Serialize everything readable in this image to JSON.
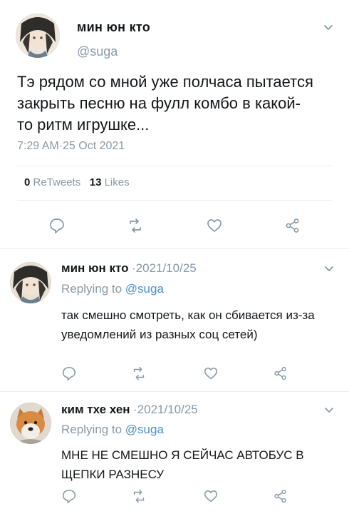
{
  "main_tweet": {
    "author_name": "мин юн кто",
    "handle": "@suga",
    "text": "Тэ рядом со мной уже полчаса пытается закрыть песню на фулл комбо в какой-то ритм игрушке...",
    "timestamp": "7:29 AM·25 Oct 2021",
    "retweets_count": "0",
    "retweets_label": "ReTweets",
    "likes_count": "13",
    "likes_label": "Likes"
  },
  "replies": [
    {
      "author_name": "мин юн кто",
      "date": "·2021/10/25",
      "replying_prefix": "Replying to",
      "replying_handle": "@suga",
      "text": "так смешно смотреть, как он сбивается из-за уведомлений из разных соц сетей)"
    },
    {
      "author_name": "ким тхе хен",
      "date": "·2021/10/25",
      "replying_prefix": "Replying to",
      "replying_handle": "@suga",
      "text": "МНЕ НЕ СМЕШНО Я СЕЙЧАС АВТОБУС В ЩЕПКИ РАЗНЕСУ"
    }
  ],
  "icons": {
    "reply": "reply-icon",
    "retweet": "retweet-icon",
    "like": "heart-icon",
    "share": "share-icon",
    "menu": "chevron-down-icon"
  },
  "colors": {
    "muted": "#8899a6",
    "link": "#4a90c9",
    "text": "#14171a",
    "divider": "#e6ecf0"
  }
}
